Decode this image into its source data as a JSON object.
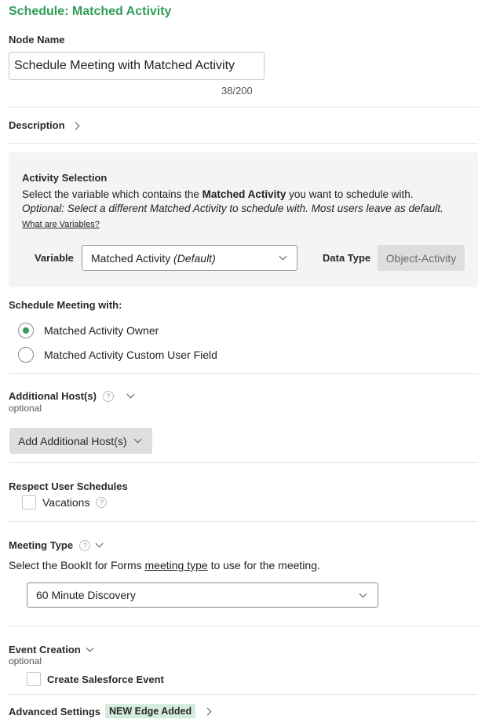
{
  "page_title": "Schedule: Matched Activity",
  "node_name": {
    "label": "Node Name",
    "value": "Schedule Meeting with Matched Activity",
    "counter": "38/200"
  },
  "description": {
    "label": "Description"
  },
  "activity_selection": {
    "heading": "Activity Selection",
    "line1_pre": "Select the variable which contains the ",
    "line1_bold": "Matched Activity",
    "line1_post": " you want to schedule with.",
    "line2": "Optional: Select a different Matched Activity to schedule with. Most users leave as default.",
    "variables_link": "What are Variables?",
    "variable_label": "Variable",
    "variable_value": "Matched Activity",
    "variable_value_suffix": "(Default)",
    "data_type_label": "Data Type",
    "data_type_value": "Object-Activity"
  },
  "schedule_with": {
    "label": "Schedule Meeting with:",
    "options": [
      {
        "label": "Matched Activity Owner",
        "selected": true
      },
      {
        "label": "Matched Activity Custom User Field",
        "selected": false
      }
    ]
  },
  "additional_hosts": {
    "label": "Additional Host(s)",
    "help": "?",
    "sub": "optional",
    "button": "Add Additional Host(s)"
  },
  "respect_schedules": {
    "label": "Respect User Schedules",
    "vacations_label": "Vacations",
    "help": "?"
  },
  "meeting_type": {
    "label": "Meeting Type",
    "help": "?",
    "desc_pre": "Select the BookIt for Forms ",
    "desc_link": "meeting type",
    "desc_post": " to use for the meeting.",
    "value": "60 Minute Discovery"
  },
  "event_creation": {
    "label": "Event Creation",
    "sub": "optional",
    "checkbox_label": "Create Salesforce Event"
  },
  "advanced_settings": {
    "label": "Advanced Settings",
    "badge": "NEW Edge Added"
  },
  "colors": {
    "accent": "#2f9e57",
    "panel": "#f4f4f4",
    "badge_bg": "#d4ecdc"
  }
}
